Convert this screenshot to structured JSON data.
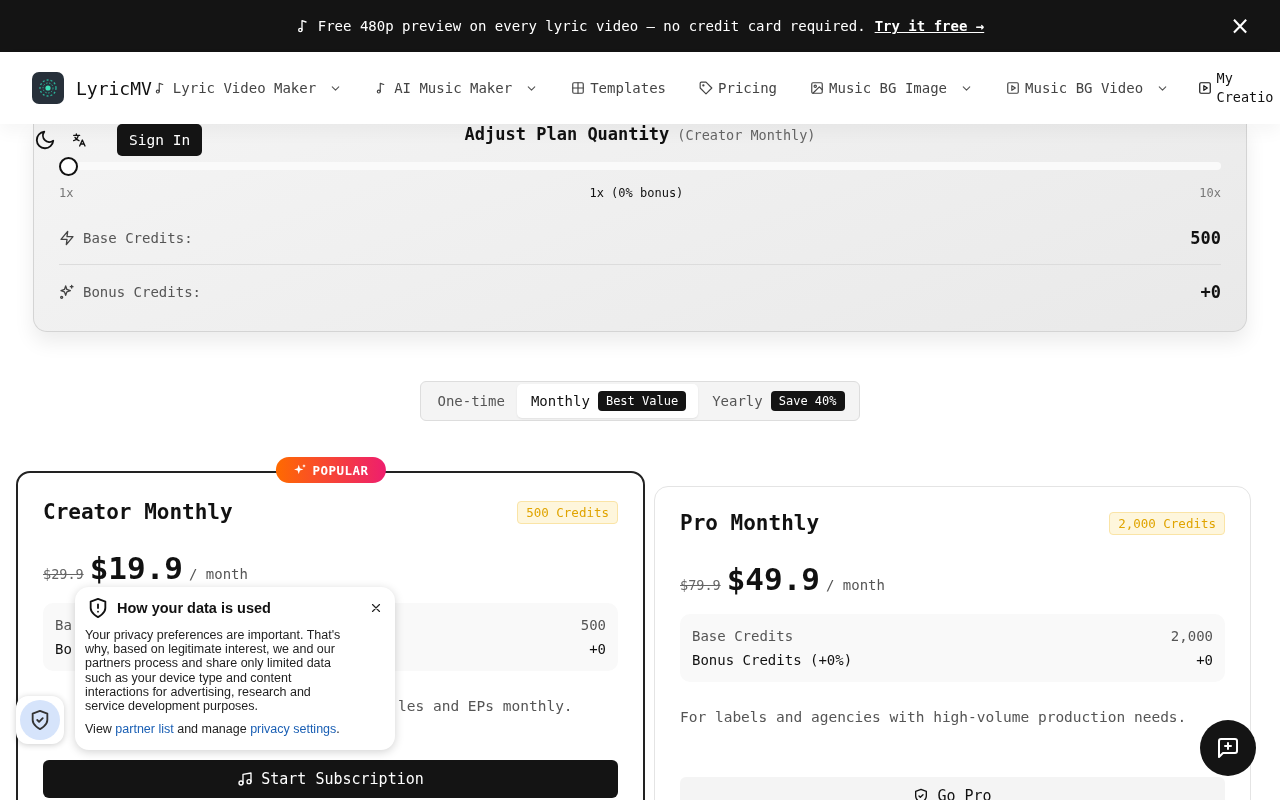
{
  "banner": {
    "text": "Free 480p preview on every lyric video — no credit card required.",
    "link": "Try it free →",
    "close": "×"
  },
  "nav": {
    "brand": "LyricMV",
    "items": [
      {
        "label": "Lyric Video Maker",
        "dropdown": true
      },
      {
        "label": "AI Music Maker",
        "dropdown": true
      },
      {
        "label": "Templates",
        "dropdown": false
      },
      {
        "label": "Pricing",
        "dropdown": false
      },
      {
        "label": "Music BG Image",
        "dropdown": true
      },
      {
        "label": "Music BG Video",
        "dropdown": true
      },
      {
        "label": "My Creatio"
      }
    ],
    "sign_in": "Sign In"
  },
  "quantity": {
    "title": "Adjust Plan Quantity",
    "plan": "(Creator Monthly)",
    "level": 0,
    "min_label": "1x",
    "current": "1x (0% bonus)",
    "max_label": "10x",
    "rows": [
      {
        "label": "Base Credits:",
        "value": "500"
      },
      {
        "label": "Bonus Credits:",
        "value": "+0"
      }
    ]
  },
  "billing": [
    {
      "label": "One-time",
      "selected": false
    },
    {
      "label": "Monthly",
      "badge": "Best Value",
      "selected": true
    },
    {
      "label": "Yearly",
      "badge": "Save 40%",
      "selected": false
    }
  ],
  "plans": [
    {
      "featured": true,
      "popular": "POPULAR",
      "name": "Creator Monthly",
      "credits": "500 Credits",
      "old_price": "$29.9",
      "price": "$19.9",
      "period": "/ month",
      "rows": [
        {
          "label": "Ba",
          "value": "500"
        },
        {
          "label": "Bo",
          "value": "+0"
        }
      ],
      "description": "les and EPs monthly.",
      "partly_covered": true,
      "button": "Start Subscription"
    },
    {
      "featured": false,
      "name": "Pro Monthly",
      "credits": "2,000 Credits",
      "old_price": "$79.9",
      "price": "$49.9",
      "period": "/ month",
      "rows": [
        {
          "label": "Base Credits",
          "value": "2,000"
        },
        {
          "label": "Bonus Credits (+0%)",
          "value": "+0"
        }
      ],
      "description": "For labels and agencies with high-volume production needs.",
      "partly_covered": false,
      "button": "Go Pro"
    }
  ],
  "privacy": {
    "title": "How your data is used",
    "body": "Your privacy preferences are important. That's why, based on legitimate interest, we and our partners process and share only limited data such as your device type and content interactions for advertising, research and service development purposes.",
    "view": "View",
    "link1": "partner list",
    "middle": "and manage",
    "link2": "privacy settings",
    "end": "."
  }
}
